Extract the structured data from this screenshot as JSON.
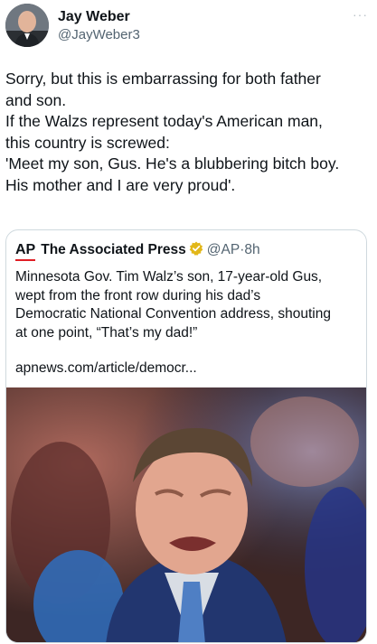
{
  "author": {
    "name": "Jay Weber",
    "handle": "@JayWeber3"
  },
  "more_menu": "···",
  "tweet_lines": [
    "Sorry, but this is embarrassing for both father",
    "and son.",
    "If the Walzs represent today's American man,",
    "this country is screwed:",
    "'Meet my son, Gus. He's a blubbering bitch boy.",
    "His mother and I are very proud'."
  ],
  "quoted": {
    "logo": "AP",
    "name": "The Associated Press",
    "handle": "@AP",
    "separator": "·",
    "time": "8h",
    "lines": [
      "Minnesota Gov. Tim Walz’s son, 17-year-old Gus,",
      "wept from the front row during his dad’s",
      "Democratic National Convention address, shouting",
      "at one point, “That’s my dad!”"
    ],
    "link": "apnews.com/article/democr..."
  },
  "colors": {
    "verified": "#e2b719",
    "ap_red": "#e01e25",
    "secondary_text": "#536471"
  }
}
